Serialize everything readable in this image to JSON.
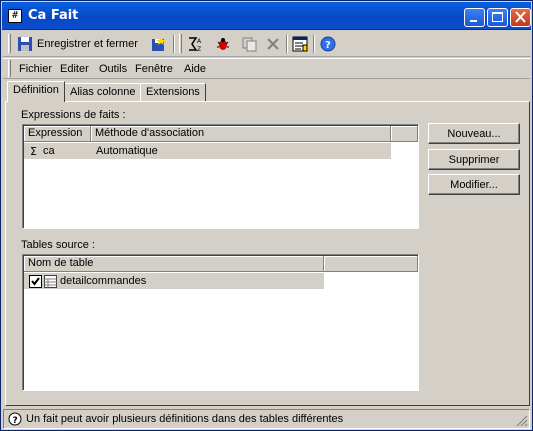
{
  "window": {
    "title": "Ca Fait",
    "app_icon_glyph": "#"
  },
  "toolbar": {
    "save_close_label": "Enregistrer et fermer",
    "icons": [
      "save-icon",
      "new-object-icon",
      "sort-icon",
      "bug-icon",
      "copy-icon",
      "delete-icon",
      "properties-icon",
      "help-icon"
    ]
  },
  "menubar": {
    "items": [
      "Fichier",
      "Editer",
      "Outils",
      "Fenêtre",
      "Aide"
    ]
  },
  "tabs": [
    {
      "label": "Définition",
      "active": true
    },
    {
      "label": "Alias colonne",
      "active": false
    },
    {
      "label": "Extensions",
      "active": false
    }
  ],
  "expressions": {
    "label": "Expressions de faits :",
    "columns": [
      "Expression",
      "Méthode d'association"
    ],
    "rows": [
      {
        "expression": "ca",
        "method": "Automatique"
      }
    ]
  },
  "source_tables": {
    "label": "Tables source :",
    "columns": [
      "Nom de table"
    ],
    "rows": [
      {
        "name": "detailcommandes",
        "checked": true
      }
    ]
  },
  "buttons": {
    "new": "Nouveau...",
    "delete": "Supprimer",
    "modify": "Modifier..."
  },
  "status": {
    "text": "Un fait peut avoir plusieurs définitions dans des tables différentes"
  },
  "colors": {
    "title_bar": "#0a5ee0",
    "window_bg": "#d4d0c8",
    "selection": "#d4d0c8"
  }
}
